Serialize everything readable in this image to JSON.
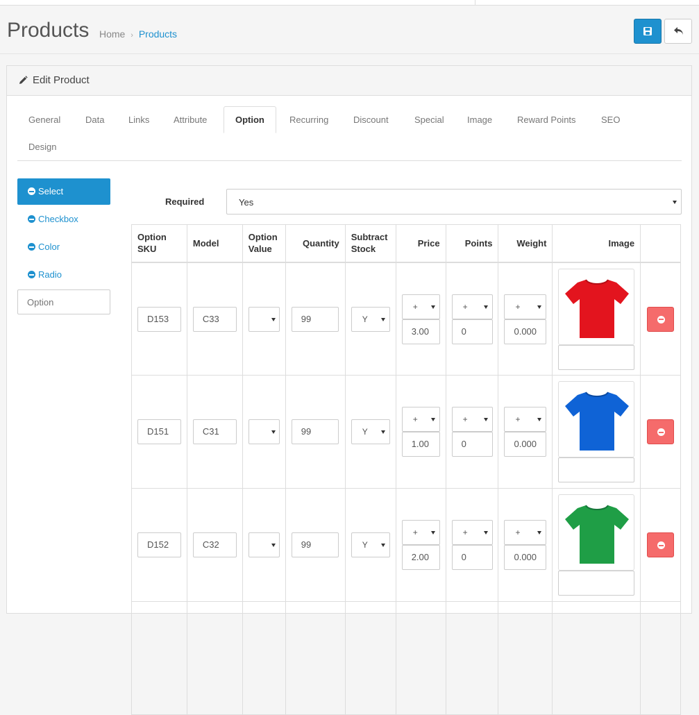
{
  "header": {
    "title": "Products",
    "breadcrumb": {
      "home": "Home",
      "separator": "›",
      "current": "Products"
    }
  },
  "panel": {
    "title": "Edit Product"
  },
  "tabs": [
    {
      "label": "General"
    },
    {
      "label": "Data"
    },
    {
      "label": "Links"
    },
    {
      "label": "Attribute"
    },
    {
      "label": "Option",
      "active": true
    },
    {
      "label": "Recurring"
    },
    {
      "label": "Discount"
    },
    {
      "label": "Special"
    },
    {
      "label": "Image"
    },
    {
      "label": "Reward Points"
    },
    {
      "label": "SEO"
    },
    {
      "label": "Design"
    }
  ],
  "option_types": [
    {
      "label": "Select",
      "active": true
    },
    {
      "label": "Checkbox"
    },
    {
      "label": "Color"
    },
    {
      "label": "Radio"
    }
  ],
  "option_input": {
    "placeholder": "Option"
  },
  "required": {
    "label": "Required",
    "value": "Yes"
  },
  "table": {
    "columns": {
      "sku_line1": "Option",
      "sku_line2": "SKU",
      "model": "Model",
      "value_line1": "Option",
      "value_line2": "Value",
      "quantity": "Quantity",
      "subtract_line1": "Subtract",
      "subtract_line2": "Stock",
      "price": "Price",
      "points": "Points",
      "weight": "Weight",
      "image": "Image"
    },
    "rows": [
      {
        "sku": "D153",
        "model": "C33",
        "option_value": "",
        "quantity": "99",
        "subtract": "Y",
        "price_prefix": "+",
        "price": "3.00",
        "points_prefix": "+",
        "points": "0",
        "weight_prefix": "+",
        "weight": "0.000",
        "image_color": "#e3141e",
        "image_icon": "red-tshirt-image"
      },
      {
        "sku": "D151",
        "model": "C31",
        "option_value": "",
        "quantity": "99",
        "subtract": "Y",
        "price_prefix": "+",
        "price": "1.00",
        "points_prefix": "+",
        "points": "0",
        "weight_prefix": "+",
        "weight": "0.000",
        "image_color": "#0f63d6",
        "image_icon": "blue-tshirt-image"
      },
      {
        "sku": "D152",
        "model": "C32",
        "option_value": "",
        "quantity": "99",
        "subtract": "Y",
        "price_prefix": "+",
        "price": "2.00",
        "points_prefix": "+",
        "points": "0",
        "weight_prefix": "+",
        "weight": "0.000",
        "image_color": "#1f9e46",
        "image_icon": "green-tshirt-image"
      }
    ]
  },
  "colors": {
    "primary": "#1e91cf",
    "danger": "#f56b6b"
  }
}
